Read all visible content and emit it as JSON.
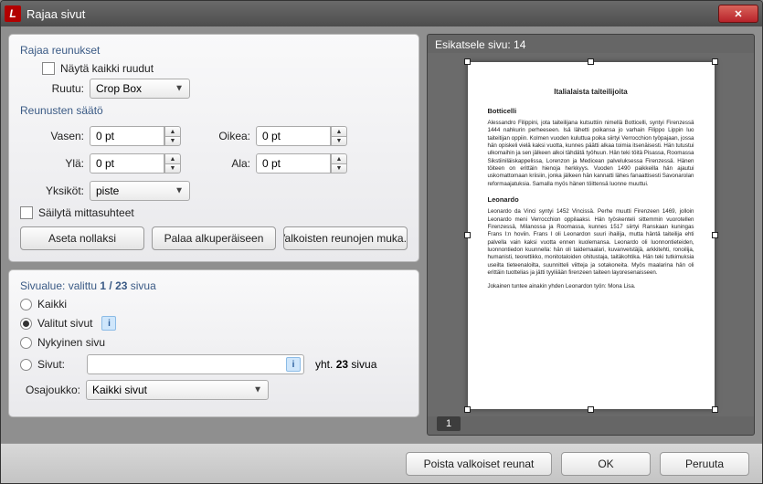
{
  "title": "Rajaa sivut",
  "group_crop": {
    "title": "Rajaa reunukset",
    "show_all": "Näytä kaikki ruudut",
    "box_label": "Ruutu:",
    "box_value": "Crop Box",
    "margins_title": "Reunusten säätö",
    "left_label": "Vasen:",
    "right_label": "Oikea:",
    "top_label": "Ylä:",
    "bottom_label": "Ala:",
    "units_label": "Yksiköt:",
    "units_value": "piste",
    "val_left": "0 pt",
    "val_right": "0 pt",
    "val_top": "0 pt",
    "val_bottom": "0 pt",
    "lock_ratio": "Säilytä mittasuhteet",
    "btn_zero": "Aseta nollaksi",
    "btn_restore": "Palaa alkuperäiseen",
    "btn_whitespace": "Valkoisten reunojen muka..."
  },
  "group_range": {
    "title_prefix": "Sivualue: valittu ",
    "title_count": "1 / 23",
    "title_suffix": " sivua",
    "opt_all": "Kaikki",
    "opt_selected": "Valitut sivut",
    "opt_current": "Nykyinen sivu",
    "opt_pages": "Sivut:",
    "pages_value": "",
    "total_prefix": "yht. ",
    "total_count": "23",
    "total_suffix": " sivua",
    "subset_label": "Osajoukko:",
    "subset_value": "Kaikki sivut"
  },
  "preview": {
    "title": "Esikatsele sivu: 14",
    "page_number": "1",
    "doc_title": "Italialaista taiteilijoita",
    "h1": "Botticelli",
    "p1": "Alessandro Filippini, jota taiteilijana kutsuttiin nimellä Botticelli, syntyi Firenzessä 1444 nahkurin perheeseen. Isä lähetti poikansa jo varhain Filippo Lippin luo taiteitijan oppiin. Kolmen vuoden kuluttua poika siirtyi Verrocchion työpajaan, jossa hän opiskeli vielä kaksi vuotta, kunnes päätti alkaa toimia itsenäisesti. Hän tutustui ulkomaihin ja sen jälkeen alkoi tähdätä työhuun. Hän teki töitä Pisassa, Roomassa Sikstiiniläiskappelissa, Lorenzon ja Medicean palveluksessa Firenzessä. Hänen töiteen on erittäin hienoja herkkyys. Vuoden 1490 paikkeilla hän ajautui uskomattomaan kriisiin, jonka jälkeen hän kannatti lähes fanaattisesti Savonarolan reformaajatuksia. Samalla myös hänen töittensä luonne muuttui.",
    "h2": "Leonardo",
    "p2": "Leonardo da Vinci syntyi 1452 Vincissä. Perhe muutti Firenzeen 1469, jolloin Leonardo meni Verrocchion oppilaaksi. Hän työskenteli sittemmin vuorotellen Firenzessä, Milanossa ja Roomassa, kunnes 1517 siirtyi Ranskaan kuningas Frans I:n hoviin. Frans I oli Leonardon suuri ihailija, mutta häntä taiteilija ehti palvella vain kaksi vuotta ennen kuolemansa. Leonardo oli luonnontieteiden, luonnontiedon kuunnella: hän oli taidemaalari, kuvanvelstäjä, arkkitehti, ronoilija, humanisti, teorettikko, monitotaloiden ohitustaja, taitäkohtika. Hän teki tutkimuksia useilta tieteenaloilta, suunnitteli viitteja ja sotakoneita. Myös maalarina hän oli erittäin tuottelias ja jätti tyyliiään firenzeen taiteen layoresenaisseen.",
    "p3": "Jokainen tuntee ainakin yhden Leonardon työn: Mona Lisa."
  },
  "footer": {
    "remove_ws": "Poista valkoiset reunat",
    "ok": "OK",
    "cancel": "Peruuta"
  }
}
